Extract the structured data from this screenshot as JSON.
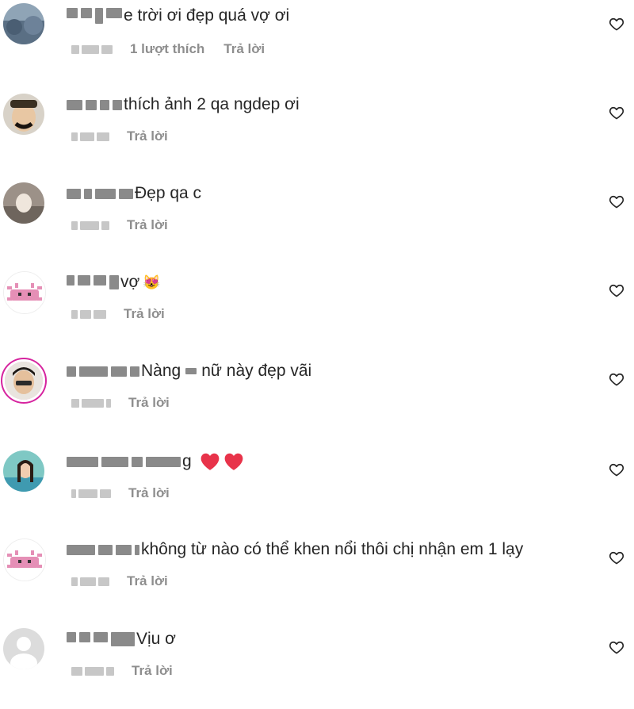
{
  "comments": [
    {
      "text": "e trời ơi đẹp quá vợ ơi",
      "likes": "1 lượt thích",
      "reply": "Trả lời"
    },
    {
      "text": "thích ảnh 2 qa ngdep ơi",
      "reply": "Trả lời"
    },
    {
      "text": "Đẹp qa c",
      "reply": "Trả lời"
    },
    {
      "text": "vợ",
      "emoji": "😻",
      "reply": "Trả lời"
    },
    {
      "text": "Nàng",
      "text2": "nữ này đẹp vãi",
      "reply": "Trả lời"
    },
    {
      "text": "g",
      "reply": "Trả lời"
    },
    {
      "text": "không từ nào có thể khen nổi thôi chị nhận em 1 lạy",
      "reply": "Trả lời"
    },
    {
      "text": "Vịu ơ",
      "reply": "Trả lời"
    }
  ],
  "colors": {
    "text": "#262626",
    "meta": "#8e8e8e",
    "heart_emoji": "#e8334a",
    "story_ring": "#d6249f"
  },
  "icons": {
    "like": "heart-outline-icon",
    "emoji_heart": "red-heart-emoji"
  }
}
